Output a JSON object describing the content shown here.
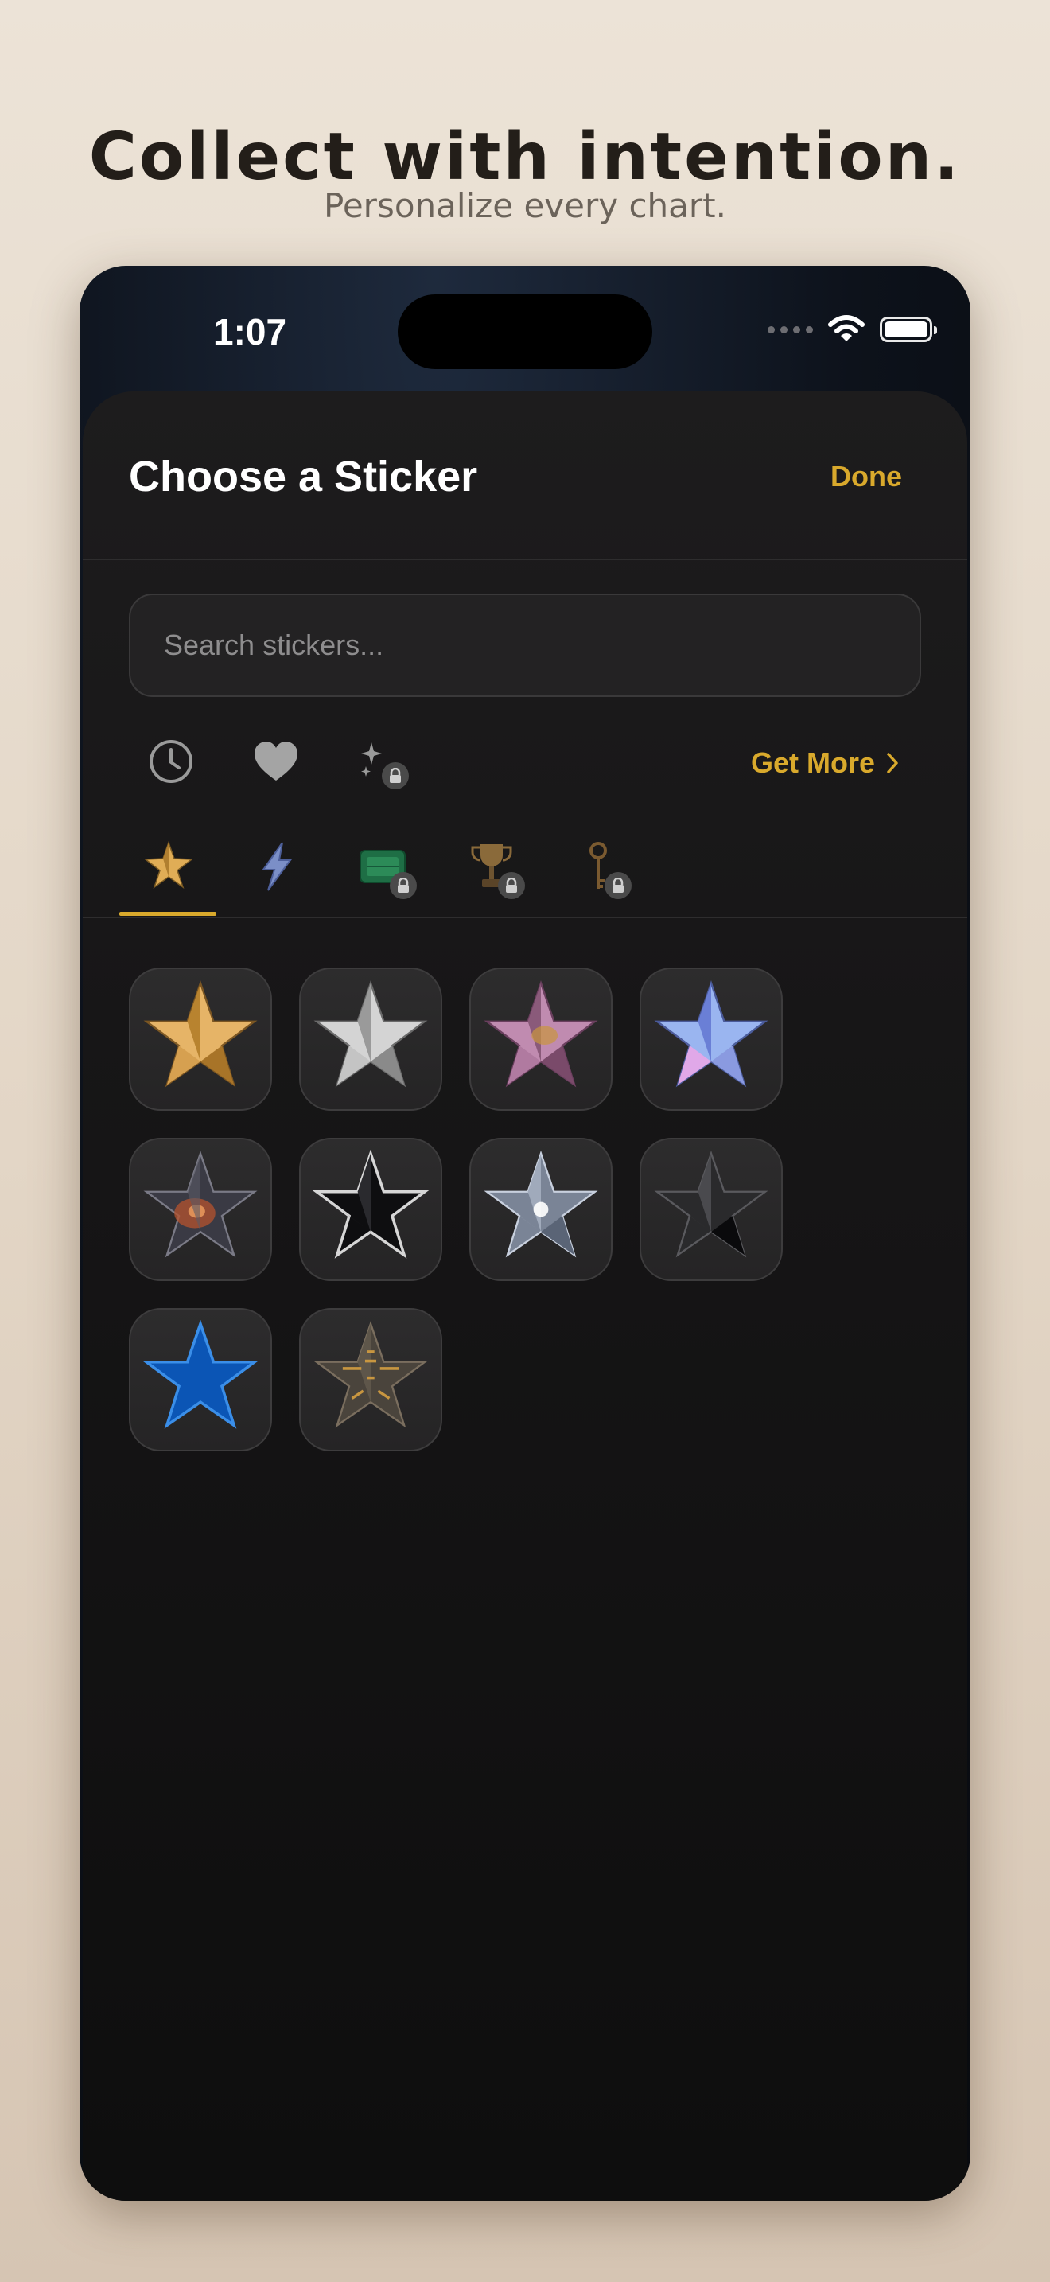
{
  "promo": {
    "headline": "Collect with intention.",
    "subheadline": "Personalize every chart."
  },
  "status_bar": {
    "time": "1:07",
    "icons": [
      "signal-dots-icon",
      "wifi-icon",
      "battery-icon"
    ]
  },
  "sheet": {
    "title": "Choose a Sticker",
    "done_label": "Done",
    "search_placeholder": "Search stickers...",
    "get_more_label": "Get More",
    "category_icons": [
      "clock-recent-icon",
      "heart-favorites-icon",
      "sparkles-locked-icon"
    ],
    "tabs": [
      {
        "icon": "gold-star-tab-icon",
        "locked": false,
        "selected": true
      },
      {
        "icon": "lightning-tab-icon",
        "locked": false,
        "selected": false
      },
      {
        "icon": "emerald-tab-icon",
        "locked": true,
        "selected": false
      },
      {
        "icon": "trophy-tab-icon",
        "locked": true,
        "selected": false
      },
      {
        "icon": "key-tab-icon",
        "locked": true,
        "selected": false
      }
    ],
    "stickers": [
      {
        "name": "gold-star",
        "color": "#d9a04a"
      },
      {
        "name": "silver-star",
        "color": "#c9c9c9"
      },
      {
        "name": "rose-gold-star",
        "color": "#b07aa0"
      },
      {
        "name": "holographic-star",
        "color": "#8aa9e8"
      },
      {
        "name": "nebula-star",
        "color": "#6e4a4a"
      },
      {
        "name": "black-glass-star",
        "color": "#1c1c1e"
      },
      {
        "name": "crystal-star",
        "color": "#9aa4b5"
      },
      {
        "name": "obsidian-star",
        "color": "#2a2a2a"
      },
      {
        "name": "blue-star",
        "color": "#0a4fa8"
      },
      {
        "name": "engraved-bronze-star",
        "color": "#4a4238"
      }
    ]
  }
}
